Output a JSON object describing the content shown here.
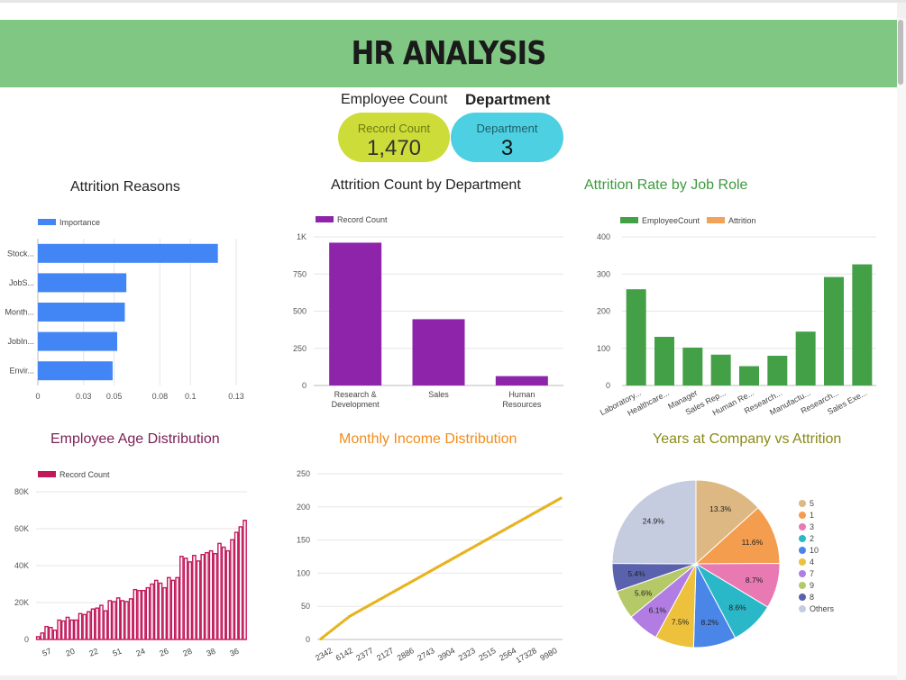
{
  "header": {
    "title": "HR ANALYSIS"
  },
  "scorecards": [
    {
      "title": "Employee Count",
      "label": "Record Count",
      "value": "1,470",
      "color": "#cddc39"
    },
    {
      "title": "Department",
      "label": "Department",
      "value": "3",
      "color": "#4dd0e1"
    }
  ],
  "colors": {
    "banner": "#81c784"
  },
  "chart_data": [
    {
      "type": "bar",
      "orientation": "horizontal",
      "title": "Attrition Reasons",
      "categories": [
        "Stock...",
        "JobS...",
        "Month...",
        "JobIn...",
        "Envir..."
      ],
      "series": [
        {
          "name": "Importance",
          "values": [
            0.118,
            0.058,
            0.057,
            0.052,
            0.049
          ],
          "color": "#4285f4"
        }
      ],
      "xticks": [
        "0",
        "0.03",
        "0.05",
        "0.08",
        "0.1",
        "0.13"
      ],
      "xlim": [
        0,
        0.13
      ],
      "legend": "top-left",
      "grid": true
    },
    {
      "type": "bar",
      "title": "Attrition Count by Department",
      "categories": [
        "Research & Development",
        "Sales",
        "Human Resources"
      ],
      "series": [
        {
          "name": "Record Count",
          "values": [
            961,
            446,
            63
          ],
          "color": "#8e24aa"
        }
      ],
      "yticks": [
        "0",
        "250",
        "500",
        "750",
        "1K"
      ],
      "ylim": [
        0,
        1000
      ],
      "legend": "top-left",
      "grid": true
    },
    {
      "type": "bar",
      "title": "Attrition Rate by Job Role",
      "categories": [
        "Laboratory...",
        "Healthcare...",
        "Manager",
        "Sales Rep...",
        "Human Re...",
        "Research...",
        "Manufactu...",
        "Research...",
        "Sales Exe..."
      ],
      "series": [
        {
          "name": "EmployeeCount",
          "values": [
            259,
            131,
            102,
            83,
            52,
            80,
            145,
            292,
            326
          ],
          "color": "#43a047"
        },
        {
          "name": "Attrition",
          "values": [
            0,
            0,
            0,
            0,
            0,
            0,
            0,
            0,
            0
          ],
          "color": "#f4a259"
        }
      ],
      "yticks": [
        "0",
        "100",
        "200",
        "300",
        "400"
      ],
      "ylim": [
        0,
        400
      ],
      "legend": "top-left",
      "grid": true
    },
    {
      "type": "bar",
      "title": "Employee Age Distribution",
      "categories": [
        "57",
        "20",
        "22",
        "51",
        "24",
        "26",
        "28",
        "38",
        "36"
      ],
      "series": [
        {
          "name": "Record Count",
          "values": [
            1500,
            3500,
            7000,
            6500,
            5000,
            10500,
            10000,
            12000,
            10500,
            10500,
            14000,
            13500,
            15000,
            16500,
            17000,
            18500,
            15500,
            21000,
            20500,
            22500,
            21000,
            20500,
            22000,
            27000,
            26500,
            26500,
            28000,
            30000,
            32000,
            30500,
            28000,
            33500,
            32000,
            33500,
            45000,
            44000,
            42000,
            45500,
            42500,
            46000,
            47000,
            48000,
            46500,
            52000,
            50000,
            48000,
            54000,
            58000,
            61000,
            64500
          ],
          "color": "#c2185b"
        }
      ],
      "yticks": [
        "0",
        "20K",
        "40K",
        "60K",
        "80K"
      ],
      "ylim": [
        0,
        80000
      ],
      "legend": "top-left",
      "grid": true
    },
    {
      "type": "line",
      "title": "Monthly Income Distribution",
      "x": [
        "2342",
        "6142",
        "2377",
        "2127",
        "2886",
        "2743",
        "3904",
        "2323",
        "2515",
        "2564",
        "17328",
        "9980"
      ],
      "series": [
        {
          "name": "",
          "y_start": 1,
          "y_end": 213,
          "color": "#e6b31e"
        }
      ],
      "yticks": [
        "0",
        "50",
        "100",
        "150",
        "200",
        "250"
      ],
      "ylim": [
        0,
        250
      ],
      "grid": true
    },
    {
      "type": "pie",
      "title": "Years at Company vs Attrition",
      "labels": [
        "5",
        "1",
        "3",
        "2",
        "10",
        "4",
        "7",
        "9",
        "8",
        "Others"
      ],
      "values": [
        13.3,
        11.6,
        8.7,
        8.6,
        8.2,
        7.5,
        6.1,
        5.6,
        5.4,
        24.9
      ],
      "value_labels": [
        "13.3%",
        "11.6%",
        "8.7%",
        "8.6%",
        "8.2%",
        "7.5%",
        "6.1%",
        "5.6%",
        "5.4%",
        "24.9%"
      ],
      "colors": [
        "#ddb882",
        "#f59d4e",
        "#e879b3",
        "#2ab8c8",
        "#4a86e8",
        "#edc13b",
        "#b17de2",
        "#b5c969",
        "#5b62ad",
        "#c5cce0"
      ],
      "legend": "right"
    }
  ]
}
